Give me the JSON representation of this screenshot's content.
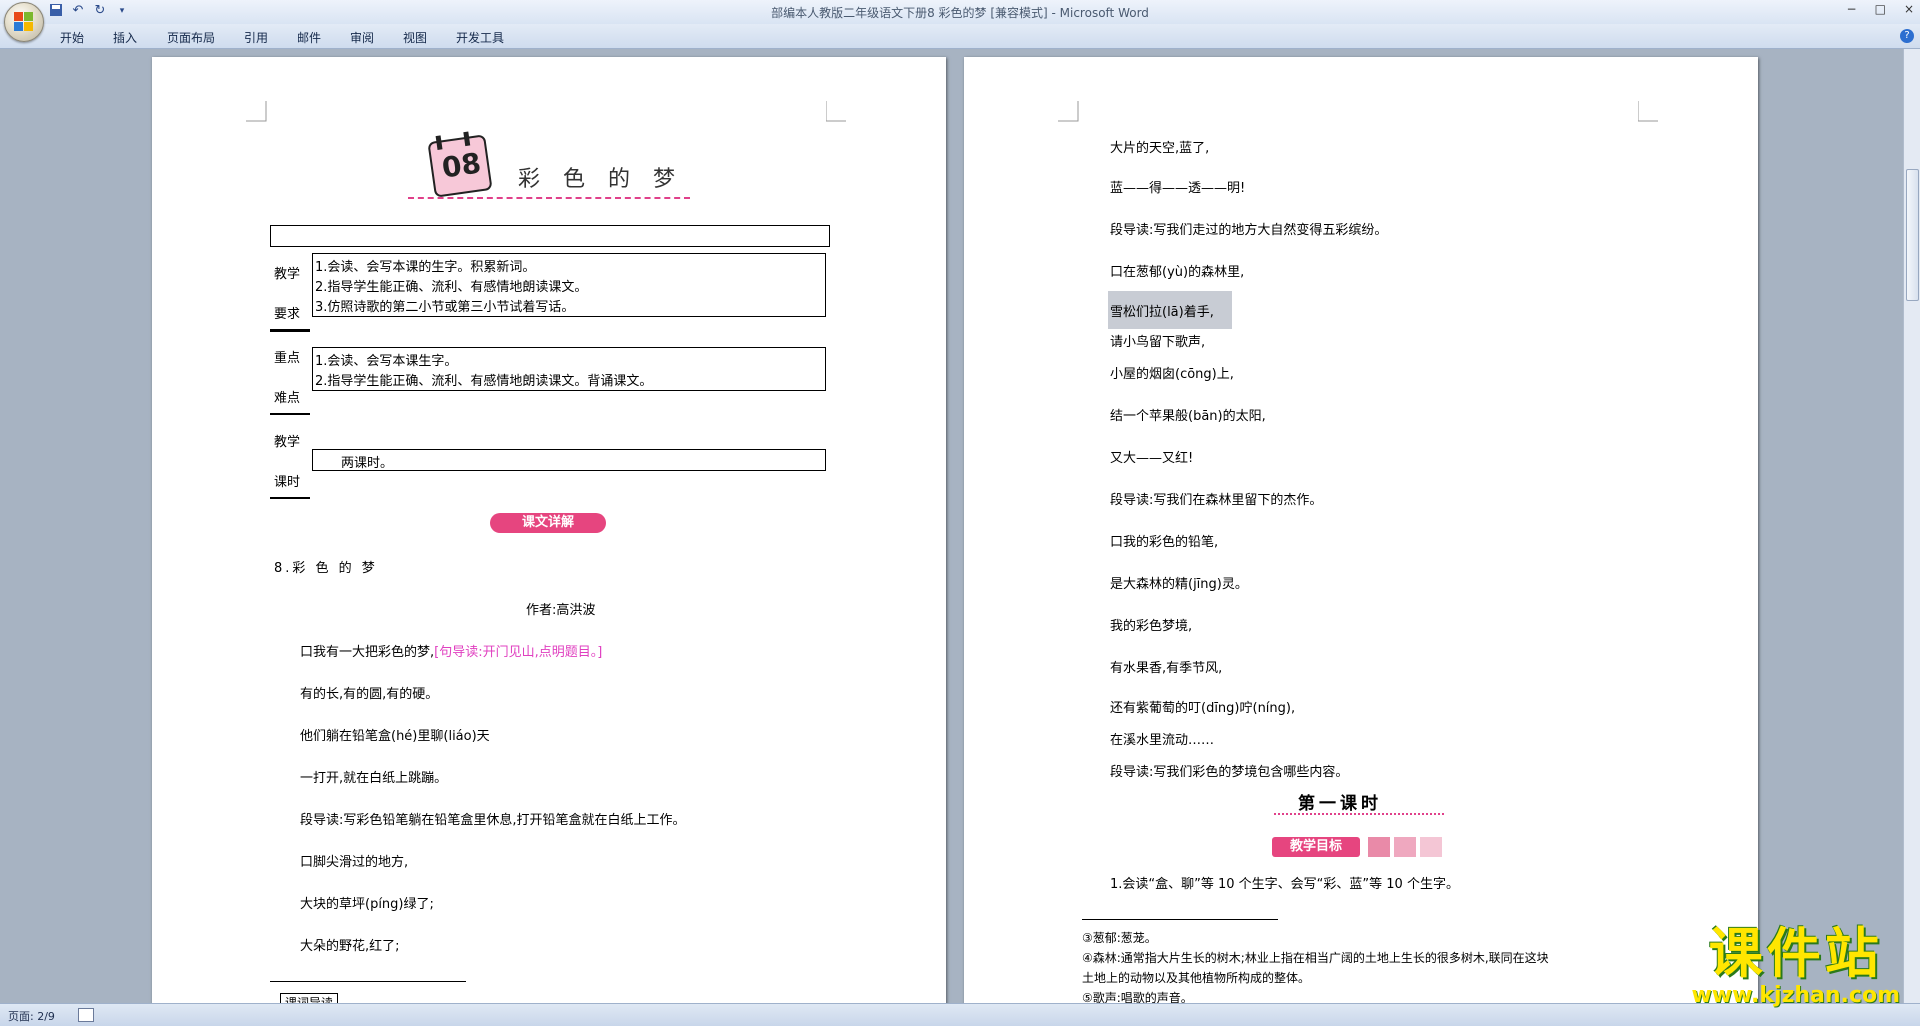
{
  "window": {
    "title": "部编本人教版二年级语文下册8 彩色的梦 [兼容模式] - Microsoft Word",
    "controls": [
      "−",
      "□",
      "×"
    ]
  },
  "ribbon": {
    "tabs": [
      "开始",
      "插入",
      "页面布局",
      "引用",
      "邮件",
      "审阅",
      "视图",
      "开发工具"
    ],
    "help": "?"
  },
  "left_page": {
    "lesson_number": "08",
    "lesson_title": "彩 色 的 梦",
    "table": {
      "row1_label_a": "教学",
      "row1_label_b": "要求",
      "row1_items": [
        "1.会读、会写本课的生字。积累新词。",
        "2.指导学生能正确、流利、有感情地朗读课文。",
        "3.仿照诗歌的第二小节或第三小节试着写话。"
      ],
      "row2_label_a": "重点",
      "row2_label_b": "难点",
      "row2_items": [
        "1.会读、会写本课生字。",
        "2.指导学生能正确、流利、有感情地朗读课文。背诵课文。"
      ],
      "row3_label_a": "教学",
      "row3_label_b": "课时",
      "row3_value": "两课时。"
    },
    "section_badge": "课文详解",
    "text_title": "8.彩 色 的 梦",
    "author": "作者:高洪波",
    "lines": [
      {
        "text": "口我有一大把彩色的梦,",
        "note": "[句导读:开门见山,点明题目。]"
      },
      {
        "text": "有的长,有的圆,有的硬。",
        "note": ""
      },
      {
        "text": "他们躺在铅笔盒(hé)里聊(liáo)天",
        "note": ""
      },
      {
        "text": "一打开,就在白纸上跳蹦。",
        "note": ""
      },
      {
        "text": "段导读:写彩色铅笔躺在铅笔盒里休息,打开铅笔盒就在白纸上工作。",
        "note": ""
      },
      {
        "text": "口脚尖滑过的地方,",
        "note": ""
      },
      {
        "text": "大块的草坪(píng)",
        "note": "绿了;"
      },
      {
        "text": "大朵的野花,红了;",
        "note": ""
      }
    ],
    "footer_label": "课词导读"
  },
  "right_page": {
    "lines": [
      "大片的天空,蓝了,",
      "蓝——得——透——明!",
      "段导读:写我们走过的地方大自然变得五彩缤纷。",
      "口在葱郁(yù)的森林里,",
      "雪松们拉(lā)着手,",
      "请小鸟留下歌声,",
      "小屋的烟囱(cōng)上,",
      "结一个苹果般(bān)的太阳,",
      "又大——又红!",
      "段导读:写我们在森林里留下的杰作。",
      "口我的彩色的铅笔,",
      "是大森林的精(jīng)灵。",
      "我的彩色梦境,",
      "有水果香,有季节风,",
      "还有紫葡萄的叮(dīng)咛(níng),",
      "在溪水里流动……",
      "段导读:写我们彩色的梦境包含哪些内容。"
    ],
    "section_title": "第一课时",
    "goal_badge": "教学目标",
    "goal_item": "1.会读“盒、聊”等 10 个生字、会写“彩、蓝”等 10 个生字。",
    "footnotes": [
      "③葱郁:葱茏。",
      "④森林:通常指大片生长的树木;林业上指在相当广阔的土地上生长的很多树木,联同在这块",
      "土地上的动物以及其他植物所构成的整体。",
      "⑤歌声:唱歌的声音。"
    ]
  },
  "status": {
    "page_info": "页面: 2/9"
  },
  "watermark": {
    "title": "课件站",
    "url": "www.kjzhan.com"
  }
}
